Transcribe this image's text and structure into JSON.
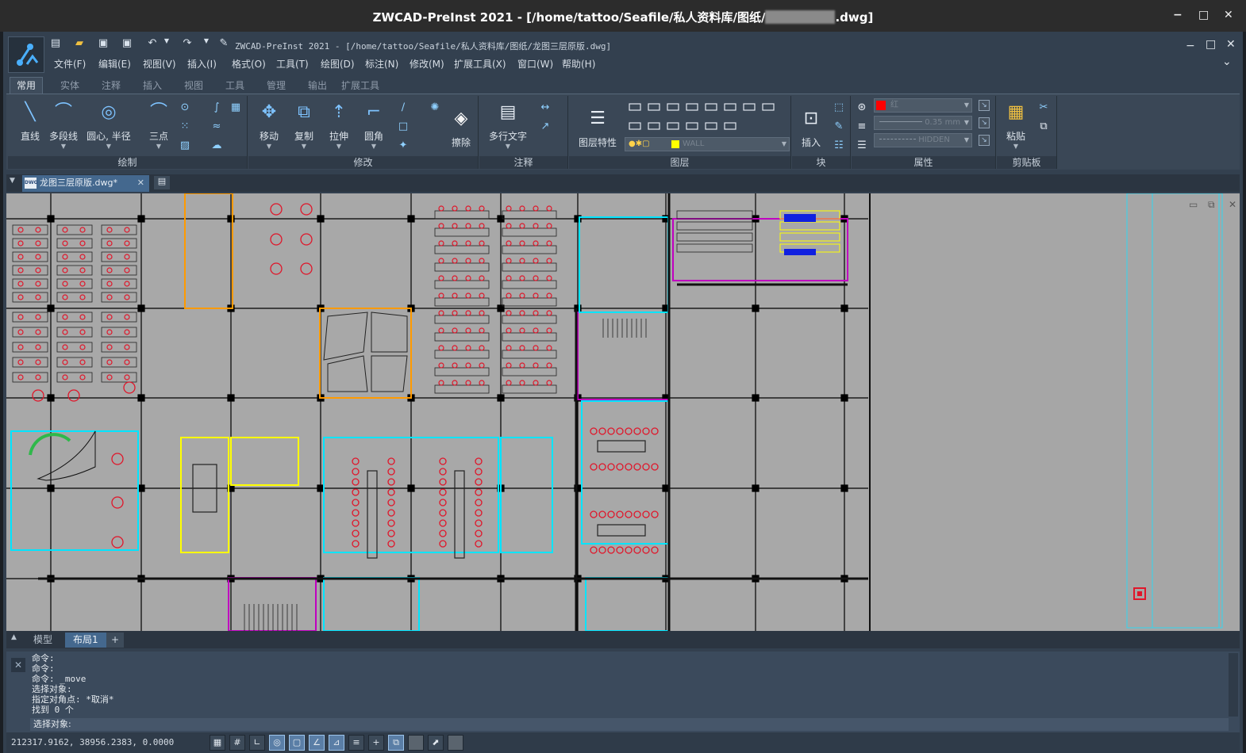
{
  "os_window": {
    "title_prefix": "ZWCAD-PreInst 2021  - [/home/tattoo/Seafile/私人资料库/图纸/",
    "title_suffix": ".dwg]",
    "min": "−",
    "max": "□",
    "close": "✕"
  },
  "app": {
    "title": "ZWCAD-PreInst 2021  - [/home/tattoo/Seafile/私人资料库/图纸/龙图三层原版.dwg]",
    "menus": [
      "文件(F)",
      "编辑(E)",
      "视图(V)",
      "插入(I)",
      "格式(O)",
      "工具(T)",
      "绘图(D)",
      "标注(N)",
      "修改(M)",
      "扩展工具(X)",
      "窗口(W)",
      "帮助(H)"
    ],
    "quick_access": [
      "new-icon",
      "open-icon",
      "save-icon",
      "save-as-icon",
      "undo-icon",
      "redo-icon",
      "match-prop-icon"
    ]
  },
  "ribbon": {
    "tabs": [
      "常用",
      "实体",
      "注释",
      "插入",
      "视图",
      "工具",
      "管理",
      "输出",
      "扩展工具"
    ],
    "active_tab": "常用",
    "panels": {
      "draw": {
        "title": "绘制",
        "buttons": [
          "直线",
          "多段线",
          "圆心, 半径",
          "三点"
        ]
      },
      "modify": {
        "title": "修改",
        "buttons": [
          "移动",
          "复制",
          "拉伸",
          "圆角",
          "擦除"
        ]
      },
      "annotate": {
        "title": "注释",
        "buttons": [
          "多行文字"
        ]
      },
      "layers": {
        "title": "图层",
        "buttons": [
          "图层特性"
        ],
        "layer_combo": "WALL"
      },
      "block": {
        "title": "块",
        "buttons": [
          "插入"
        ]
      },
      "properties": {
        "title": "属性",
        "color": "红",
        "color_hex": "#ff0000",
        "lineweight": "0.35 mm",
        "linetype": "HIDDEN"
      },
      "clipboard": {
        "title": "剪贴板",
        "buttons": [
          "粘贴"
        ]
      }
    }
  },
  "document_tab": {
    "label": "龙图三层原版.dwg*",
    "icon_text": "DWG"
  },
  "layout_tabs": [
    "模型",
    "布局1"
  ],
  "layout_active": "布局1",
  "command": {
    "history": [
      "命令:",
      "命令:",
      "命令: _move",
      "选择对象:",
      "指定对角点: *取消*",
      "找到 0 个"
    ],
    "prompt": "选择对象:"
  },
  "status": {
    "coordinates": "212317.9162, 38956.2383, 0.0000",
    "toggles": [
      "snap-grid",
      "grid",
      "ortho",
      "polar",
      "osnap",
      "otrack",
      "dynamic-ucs",
      "lineweight",
      "dynamic-input",
      "selection-cycle",
      "annotation",
      "workspace",
      "lock"
    ]
  },
  "colors": {
    "accent": "#44688e",
    "ribbon_bg": "#3a4756",
    "canvas_bg": "#a6a6a6",
    "wall": "#000000",
    "furniture": "#e0162a",
    "fixture": "#ffff00",
    "partition": "#c000c0",
    "glass": "#00e5ff"
  }
}
